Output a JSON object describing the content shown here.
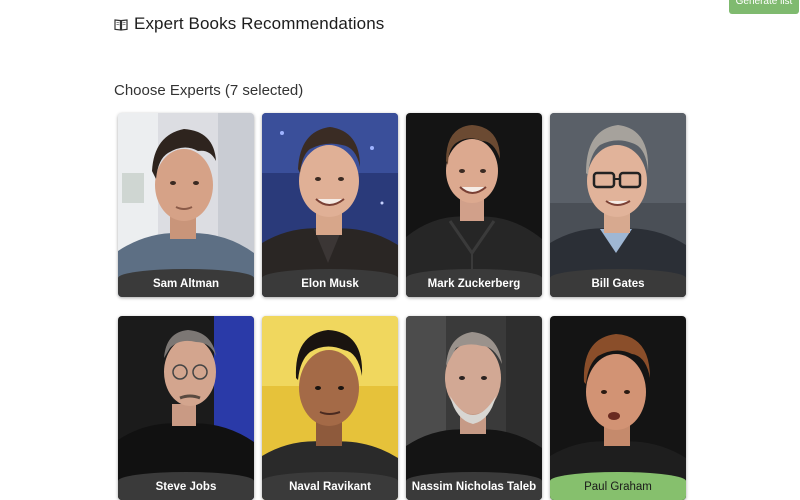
{
  "header": {
    "title": "Expert Books Recommendations",
    "icon": "book-icon"
  },
  "toolbar": {
    "generate_label": "Generate list",
    "generate_color": "#7fba6f"
  },
  "selection": {
    "label": "Choose Experts (7 selected)"
  },
  "experts": [
    {
      "name": "Sam Altman"
    },
    {
      "name": "Elon Musk"
    },
    {
      "name": "Mark Zuckerberg"
    },
    {
      "name": "Bill Gates"
    },
    {
      "name": "Steve Jobs"
    },
    {
      "name": "Naval Ravikant"
    },
    {
      "name": "Nassim Nicholas Taleb"
    },
    {
      "name": "Paul Graham"
    }
  ],
  "colors": {
    "name_bar": "#3a3a3a",
    "name_bar_highlight": "#86c06d"
  }
}
